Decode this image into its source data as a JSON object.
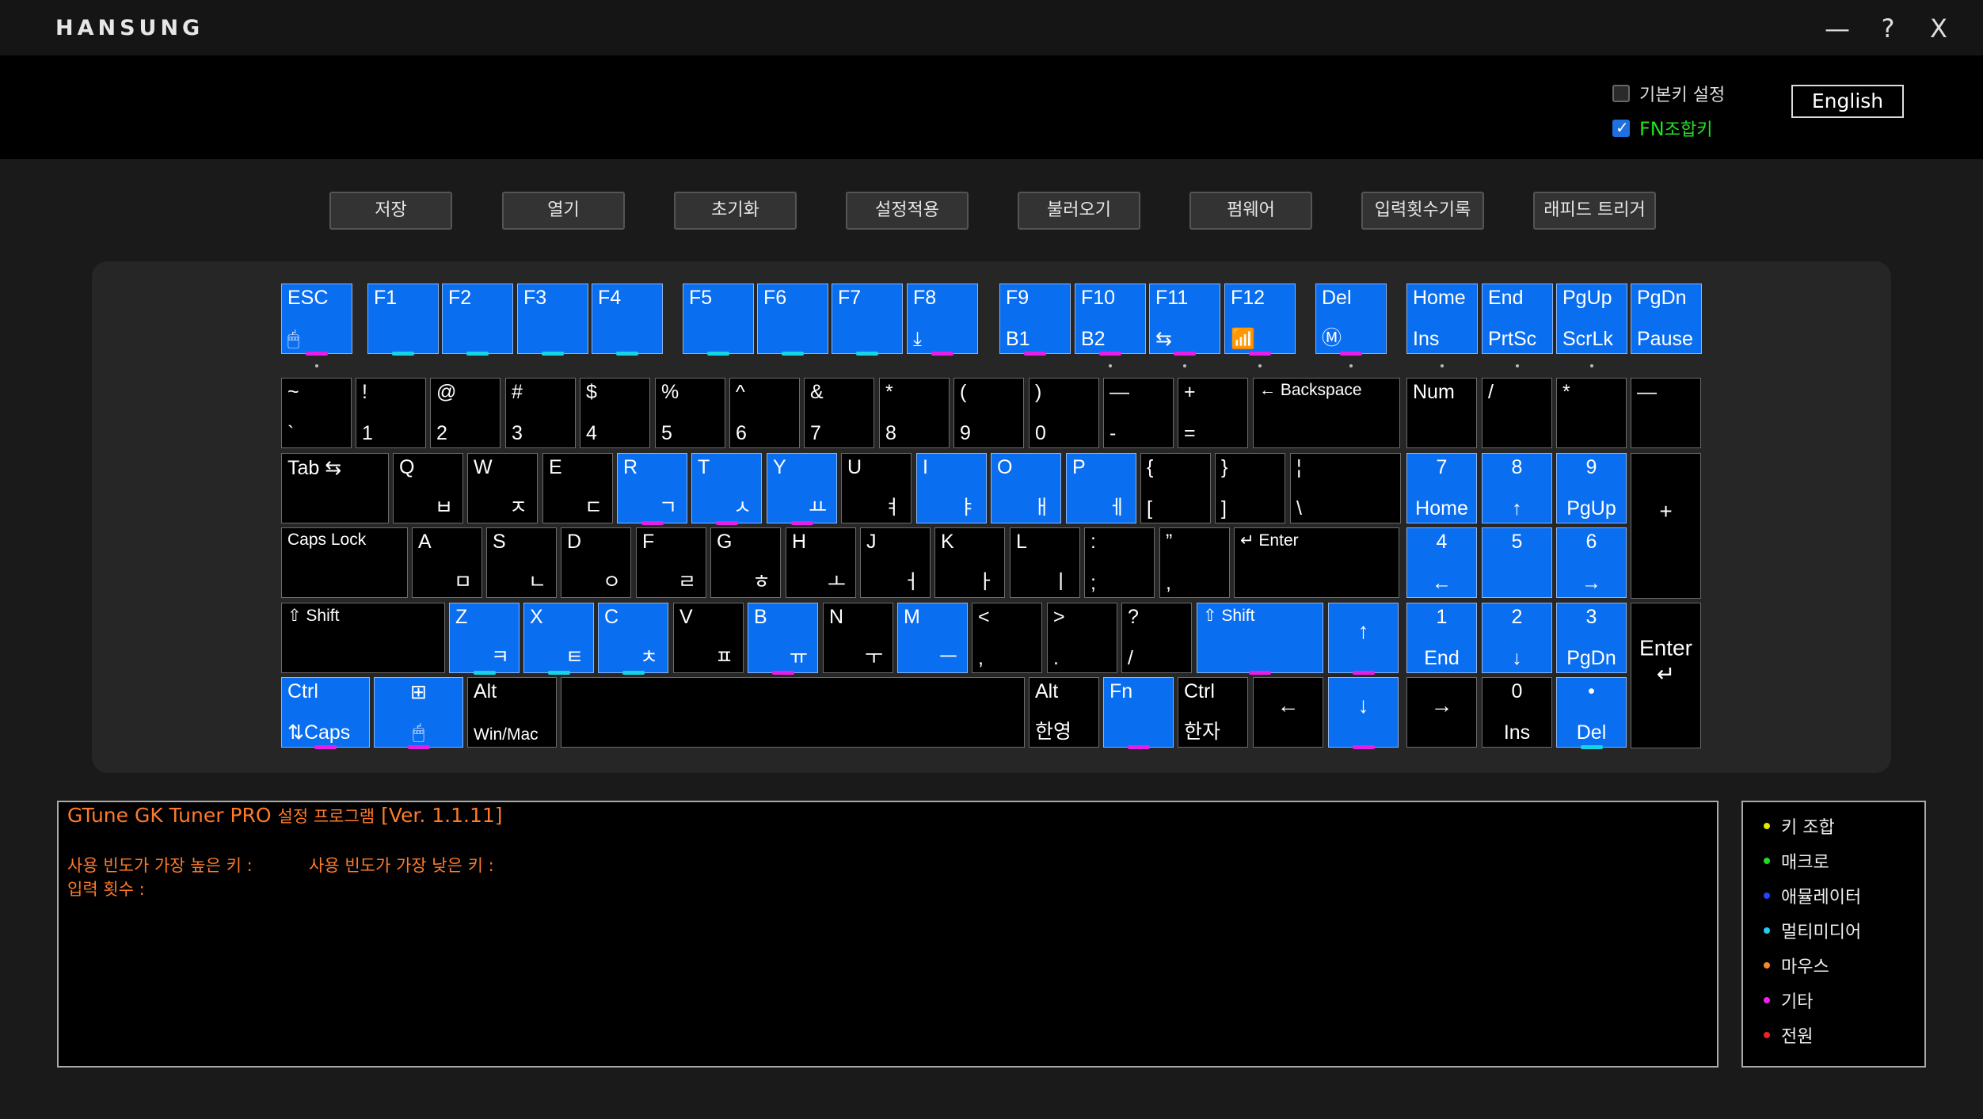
{
  "app": {
    "brand": "HANSUNG"
  },
  "window_controls": {
    "minimize": "—",
    "help": "?",
    "close": "X"
  },
  "options": {
    "default_key": {
      "label": "기본키 설정",
      "checked": false
    },
    "fn_combo": {
      "label_fn": "FN",
      "label_rest": "조합키",
      "checked": true
    }
  },
  "language_button": "English",
  "toolbar": [
    "저장",
    "열기",
    "초기화",
    "설정적용",
    "불러오기",
    "펌웨어",
    "입력횟수기록",
    "래피드 트리거"
  ],
  "colors": {
    "key_blue": "#0a6ef0",
    "marker_magenta": "#e61ee6",
    "marker_cyan": "#18d2e6",
    "console_text": "#ff7a2a",
    "fn_green": "#22e022"
  },
  "keyboard": {
    "row_f": [
      {
        "t": "ESC",
        "b": "🖱",
        "blue": true,
        "m": "magenta",
        "dot": true
      },
      {
        "t": "F1",
        "blue": true,
        "m": "cyan"
      },
      {
        "t": "F2",
        "blue": true,
        "m": "cyan"
      },
      {
        "t": "F3",
        "blue": true,
        "m": "cyan"
      },
      {
        "t": "F4",
        "blue": true,
        "m": "cyan"
      },
      {
        "t": "F5",
        "blue": true,
        "m": "cyan"
      },
      {
        "t": "F6",
        "blue": true,
        "m": "cyan"
      },
      {
        "t": "F7",
        "blue": true,
        "m": "cyan"
      },
      {
        "t": "F8",
        "b": "⤓",
        "blue": true,
        "m": "magenta"
      },
      {
        "t": "F9",
        "b": "B1",
        "blue": true,
        "m": "magenta"
      },
      {
        "t": "F10",
        "b": "B2",
        "blue": true,
        "m": "magenta",
        "dot": true
      },
      {
        "t": "F11",
        "b": "⇆",
        "blue": true,
        "m": "magenta",
        "dot": true
      },
      {
        "t": "F12",
        "b": "📶",
        "blue": true,
        "m": "magenta",
        "dot": true
      },
      {
        "t": "Del",
        "b": "Ⓜ",
        "blue": true,
        "m": "magenta",
        "dot": true
      },
      {
        "t": "Home",
        "b": "Ins",
        "blue": true,
        "dot": true
      },
      {
        "t": "End",
        "b": "PrtSc",
        "blue": true,
        "dot": true
      },
      {
        "t": "PgUp",
        "b": "ScrLk",
        "blue": true,
        "dot": true
      },
      {
        "t": "PgDn",
        "b": "Pause",
        "blue": true
      }
    ],
    "row_num": [
      {
        "t": "~",
        "b": "`"
      },
      {
        "t": "!",
        "b": "1"
      },
      {
        "t": "@",
        "b": "2"
      },
      {
        "t": "#",
        "b": "3"
      },
      {
        "t": "$",
        "b": "4"
      },
      {
        "t": "%",
        "b": "5"
      },
      {
        "t": "^",
        "b": "6"
      },
      {
        "t": "&",
        "b": "7"
      },
      {
        "t": "*",
        "b": "8"
      },
      {
        "t": "(",
        "b": "9"
      },
      {
        "t": ")",
        "b": "0"
      },
      {
        "t": "—",
        "b": "-"
      },
      {
        "t": "+",
        "b": "="
      },
      {
        "t": "← Backspace"
      },
      {
        "t": "Num"
      },
      {
        "t": "/"
      },
      {
        "t": "*"
      },
      {
        "t": "—"
      }
    ],
    "row_tab": [
      {
        "t": "Tab ⇆"
      },
      {
        "t": "Q",
        "br": "ㅂ"
      },
      {
        "t": "W",
        "br": "ㅈ"
      },
      {
        "t": "E",
        "br": "ㄷ"
      },
      {
        "t": "R",
        "br": "ㄱ",
        "blue": true,
        "m": "magenta"
      },
      {
        "t": "T",
        "br": "ㅅ",
        "blue": true,
        "m": "magenta"
      },
      {
        "t": "Y",
        "br": "ㅛ",
        "blue": true,
        "m": "magenta"
      },
      {
        "t": "U",
        "br": "ㅕ"
      },
      {
        "t": "I",
        "br": "ㅑ",
        "blue": true
      },
      {
        "t": "O",
        "br": "ㅐ",
        "blue": true
      },
      {
        "t": "P",
        "br": "ㅔ",
        "blue": true
      },
      {
        "t": "{",
        "b": "["
      },
      {
        "t": "}",
        "b": "]"
      },
      {
        "t": "¦",
        "b": "\\"
      },
      {
        "t": "7",
        "b": "Home",
        "blue": true,
        "c": true
      },
      {
        "t": "8",
        "b": "↑",
        "blue": true,
        "c": true
      },
      {
        "t": "9",
        "b": "PgUp",
        "blue": true,
        "c": true
      },
      {
        "tc": "+"
      }
    ],
    "row_caps": [
      {
        "t": "Caps Lock"
      },
      {
        "t": "A",
        "br": "ㅁ"
      },
      {
        "t": "S",
        "br": "ㄴ"
      },
      {
        "t": "D",
        "br": "ㅇ"
      },
      {
        "t": "F",
        "br": "ㄹ"
      },
      {
        "t": "G",
        "br": "ㅎ"
      },
      {
        "t": "H",
        "br": "ㅗ"
      },
      {
        "t": "J",
        "br": "ㅓ"
      },
      {
        "t": "K",
        "br": "ㅏ"
      },
      {
        "t": "L",
        "br": "ㅣ"
      },
      {
        "t": ":",
        "b": ";"
      },
      {
        "t": "”",
        "b": ","
      },
      {
        "t": "↵ Enter"
      },
      {
        "t": "4",
        "b": "←",
        "blue": true,
        "c": true
      },
      {
        "t": "5",
        "blue": true,
        "c": true
      },
      {
        "t": "6",
        "b": "→",
        "blue": true,
        "c": true
      }
    ],
    "row_shift": [
      {
        "t": "⇧ Shift"
      },
      {
        "t": "Z",
        "br": "ㅋ",
        "blue": true,
        "m": "cyan"
      },
      {
        "t": "X",
        "br": "ㅌ",
        "blue": true,
        "m": "cyan"
      },
      {
        "t": "C",
        "br": "ㅊ",
        "blue": true,
        "m": "cyan"
      },
      {
        "t": "V",
        "br": "ㅍ"
      },
      {
        "t": "B",
        "br": "ㅠ",
        "blue": true,
        "m": "magenta"
      },
      {
        "t": "N",
        "br": "ㅜ"
      },
      {
        "t": "M",
        "br": "ㅡ",
        "blue": true
      },
      {
        "t": "<",
        "b": ","
      },
      {
        "t": ">",
        "b": "."
      },
      {
        "t": "?",
        "b": "/"
      },
      {
        "t": "⇧ Shift",
        "blue": true,
        "m": "magenta"
      },
      {
        "tc": "↑",
        "blue": true,
        "m": "magenta"
      },
      {
        "t": "1",
        "b": "End",
        "blue": true,
        "c": true
      },
      {
        "t": "2",
        "b": "↓",
        "blue": true,
        "c": true
      },
      {
        "t": "3",
        "b": "PgDn",
        "blue": true,
        "c": true
      },
      {
        "tc": "Enter ↵"
      }
    ],
    "row_ctrl": [
      {
        "t": "Ctrl",
        "b": "⇅Caps",
        "blue": true,
        "m": "magenta"
      },
      {
        "t": "⊞",
        "b": "🖱",
        "blue": true,
        "m": "magenta",
        "c": true
      },
      {
        "t": "Alt",
        "b": "Win/Mac"
      },
      {
        "t": ""
      },
      {
        "t": "Alt",
        "b": "한영"
      },
      {
        "t": "Fn",
        "blue": true,
        "m": "magenta"
      },
      {
        "t": "Ctrl",
        "b": "한자"
      },
      {
        "tc": "←"
      },
      {
        "tc": "↓",
        "blue": true,
        "m": "magenta"
      },
      {
        "tc": "→"
      },
      {
        "t": "0",
        "b": "Ins",
        "c": true
      },
      {
        "t": "•",
        "b": "Del",
        "blue": true,
        "m": "cyan",
        "c": true
      }
    ]
  },
  "console": {
    "title_a": "GTune GK Tuner PRO ",
    "title_b": "설정 프로그램",
    "title_c": " [Ver. 1.1.11]",
    "most_used": "사용 빈도가 가장 높은 키 :",
    "least_used": "사용 빈도가 가장 낮은 키 :",
    "count": "입력 횟수 :"
  },
  "legend": [
    {
      "label": "키 조합",
      "color": "#e6e600"
    },
    {
      "label": "매크로",
      "color": "#22dd22"
    },
    {
      "label": "애뮬레이터",
      "color": "#2244ff"
    },
    {
      "label": "멀티미디어",
      "color": "#22ccee"
    },
    {
      "label": "마우스",
      "color": "#ff8822"
    },
    {
      "label": "기타",
      "color": "#ee22ee"
    },
    {
      "label": "전원",
      "color": "#ee2222"
    }
  ]
}
